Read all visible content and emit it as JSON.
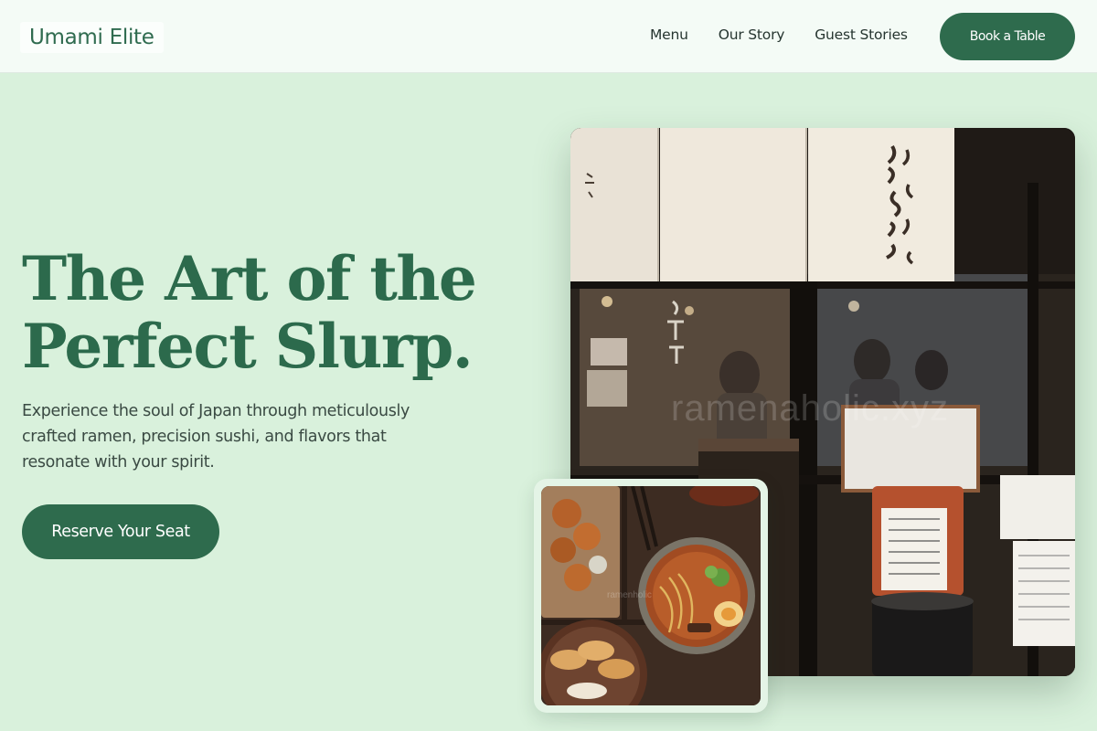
{
  "brand": {
    "name": "Umami Elite"
  },
  "nav": {
    "links": [
      "Menu",
      "Our Story",
      "Guest Stories"
    ],
    "cta_label": "Book a Table"
  },
  "hero": {
    "title_line1": "The Art of the",
    "title_line2": "Perfect Slurp.",
    "subtitle": "Experience the soul of Japan through meticulously crafted ramen, precision sushi, and flavors that resonate with your spirit.",
    "cta_label": "Reserve Your Seat"
  },
  "images": {
    "main": {
      "name": "restaurant-storefront-photo",
      "watermark": "ramenaholic.xyz"
    },
    "secondary": {
      "name": "ramen-and-dishes-photo",
      "watermark": "ramenholic"
    }
  },
  "colors": {
    "background": "#d9f1dc",
    "primary": "#2e6b4d",
    "nav_bg": "#f4fbf6",
    "text": "#3a4a43"
  }
}
